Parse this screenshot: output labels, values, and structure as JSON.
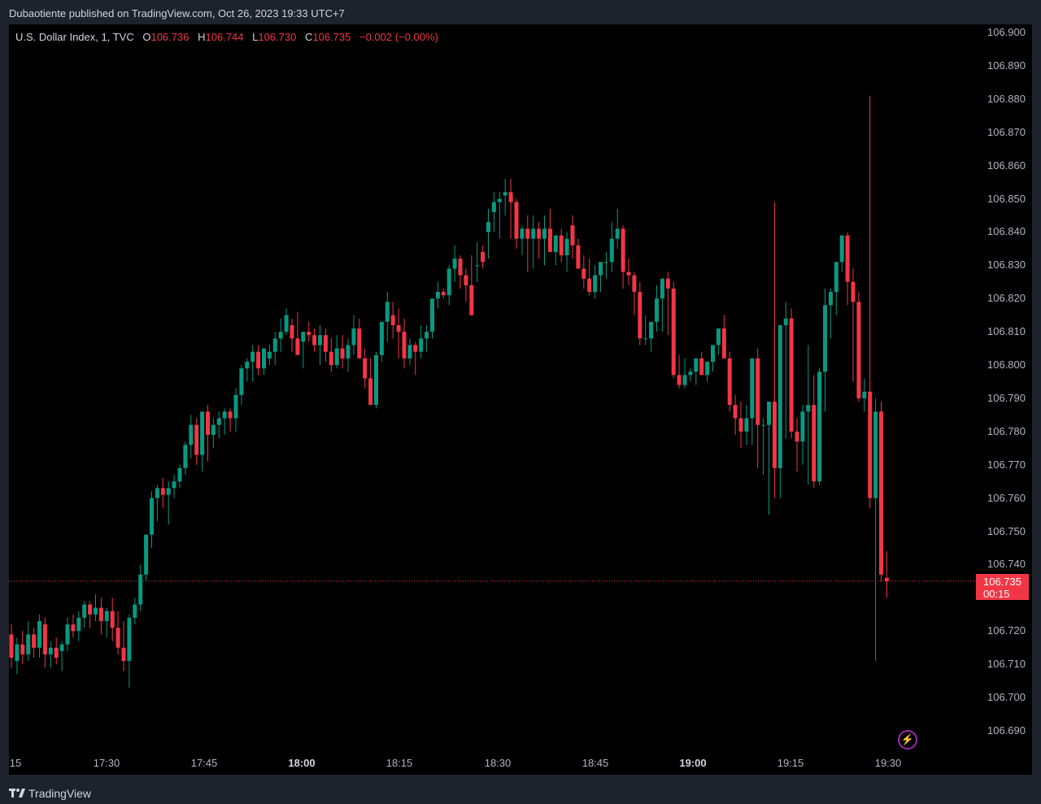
{
  "header": {
    "published_line": "Dubaotiente published on TradingView.com, Oct 26, 2023 19:33 UTC+7"
  },
  "legend": {
    "symbol": "U.S. Dollar Index, 1, TVC",
    "o_label": "O",
    "o_value": "106.736",
    "h_label": "H",
    "h_value": "106.744",
    "l_label": "L",
    "l_value": "106.730",
    "c_label": "C",
    "c_value": "106.735",
    "change": "−0.002 (−0.00%)"
  },
  "price_axis": {
    "ticks": [
      "106.900",
      "106.890",
      "106.880",
      "106.870",
      "106.860",
      "106.850",
      "106.840",
      "106.830",
      "106.820",
      "106.810",
      "106.800",
      "106.790",
      "106.780",
      "106.770",
      "106.760",
      "106.750",
      "106.740",
      "106.720",
      "106.710",
      "106.700",
      "106.690"
    ]
  },
  "last_price": {
    "value": "106.735",
    "countdown": "00:15"
  },
  "time_axis": {
    "labels": [
      {
        "text": "15",
        "bold": false
      },
      {
        "text": "17:30",
        "bold": false
      },
      {
        "text": "17:45",
        "bold": false
      },
      {
        "text": "18:00",
        "bold": true
      },
      {
        "text": "18:15",
        "bold": false
      },
      {
        "text": "18:30",
        "bold": false
      },
      {
        "text": "18:45",
        "bold": false
      },
      {
        "text": "19:00",
        "bold": true
      },
      {
        "text": "19:15",
        "bold": false
      },
      {
        "text": "19:30",
        "bold": false
      }
    ]
  },
  "footer": {
    "brand": "TradingView"
  },
  "colors": {
    "up": "#089981",
    "down": "#f23645",
    "background": "#000000",
    "frame": "#1e222d"
  },
  "chart_data": {
    "type": "candlestick",
    "ylim": [
      106.686,
      106.904
    ],
    "xlabels": [
      "17:30",
      "17:45",
      "18:00",
      "18:15",
      "18:30",
      "18:45",
      "19:00",
      "19:15",
      "19:30"
    ],
    "candles": [
      [
        106.719,
        106.722,
        106.709,
        106.712
      ],
      [
        106.711,
        106.718,
        106.707,
        106.716
      ],
      [
        106.716,
        106.72,
        106.71,
        106.713
      ],
      [
        106.713,
        106.723,
        106.711,
        106.719
      ],
      [
        106.719,
        106.721,
        106.712,
        106.715
      ],
      [
        106.715,
        106.725,
        106.712,
        106.723
      ],
      [
        106.722,
        106.724,
        106.709,
        106.713
      ],
      [
        106.713,
        106.717,
        106.709,
        106.715
      ],
      [
        106.715,
        106.718,
        106.71,
        106.712
      ],
      [
        106.714,
        106.717,
        106.708,
        106.716
      ],
      [
        106.716,
        106.724,
        106.714,
        106.722
      ],
      [
        106.722,
        106.725,
        106.718,
        106.72
      ],
      [
        106.72,
        106.726,
        106.717,
        106.724
      ],
      [
        106.724,
        106.729,
        106.721,
        106.728
      ],
      [
        106.728,
        106.729,
        106.721,
        106.725
      ],
      [
        106.725,
        106.731,
        106.723,
        106.727
      ],
      [
        106.727,
        106.73,
        106.719,
        106.723
      ],
      [
        106.723,
        106.727,
        106.718,
        106.726
      ],
      [
        106.726,
        106.73,
        106.717,
        106.721
      ],
      [
        106.721,
        106.726,
        106.713,
        106.715
      ],
      [
        106.715,
        106.723,
        106.708,
        106.711
      ],
      [
        106.711,
        106.725,
        106.703,
        106.724
      ],
      [
        106.724,
        106.73,
        106.722,
        106.728
      ],
      [
        106.728,
        106.74,
        106.726,
        106.737
      ],
      [
        106.737,
        106.746,
        106.735,
        106.749
      ],
      [
        106.749,
        106.762,
        106.745,
        106.76
      ],
      [
        106.76,
        106.764,
        106.753,
        106.763
      ],
      [
        106.763,
        106.766,
        106.757,
        106.761
      ],
      [
        106.761,
        106.765,
        106.752,
        106.763
      ],
      [
        106.763,
        106.767,
        106.76,
        106.765
      ],
      [
        106.765,
        106.77,
        106.763,
        106.769
      ],
      [
        106.769,
        106.777,
        106.767,
        106.776
      ],
      [
        106.776,
        106.785,
        106.772,
        106.782
      ],
      [
        106.782,
        106.784,
        106.77,
        106.773
      ],
      [
        106.773,
        106.783,
        106.768,
        106.786
      ],
      [
        106.786,
        106.788,
        106.771,
        106.779
      ],
      [
        106.779,
        106.784,
        106.775,
        106.782
      ],
      [
        106.782,
        106.786,
        106.778,
        106.784
      ],
      [
        106.784,
        106.787,
        106.779,
        106.786
      ],
      [
        106.786,
        106.787,
        106.78,
        106.784
      ],
      [
        106.784,
        106.793,
        106.78,
        106.791
      ],
      [
        106.791,
        106.8,
        106.788,
        106.799
      ],
      [
        106.799,
        106.802,
        106.795,
        106.801
      ],
      [
        106.801,
        106.806,
        106.795,
        106.804
      ],
      [
        106.804,
        106.806,
        106.797,
        106.799
      ],
      [
        106.799,
        106.804,
        106.797,
        106.805
      ],
      [
        106.802,
        106.806,
        106.8,
        106.804
      ],
      [
        106.804,
        106.81,
        106.8,
        106.808
      ],
      [
        106.808,
        106.814,
        106.804,
        106.81
      ],
      [
        106.81,
        106.817,
        106.809,
        106.815
      ],
      [
        106.812,
        106.814,
        106.804,
        106.808
      ],
      [
        106.808,
        106.816,
        106.805,
        106.803
      ],
      [
        106.807,
        106.81,
        106.799,
        106.81
      ],
      [
        106.81,
        106.813,
        106.807,
        106.809
      ],
      [
        106.809,
        106.811,
        106.804,
        106.806
      ],
      [
        106.806,
        106.812,
        106.8,
        106.809
      ],
      [
        106.809,
        106.811,
        106.801,
        106.804
      ],
      [
        106.804,
        106.808,
        106.798,
        106.8
      ],
      [
        106.8,
        106.809,
        106.799,
        106.805
      ],
      [
        106.805,
        106.809,
        106.799,
        106.802
      ],
      [
        106.802,
        106.808,
        106.798,
        106.806
      ],
      [
        106.806,
        106.815,
        106.803,
        106.811
      ],
      [
        106.811,
        106.814,
        106.802,
        106.802
      ],
      [
        106.802,
        106.805,
        106.793,
        106.796
      ],
      [
        106.796,
        106.802,
        106.789,
        106.788
      ],
      [
        106.788,
        106.804,
        106.787,
        106.803
      ],
      [
        106.803,
        106.812,
        106.801,
        106.813
      ],
      [
        106.813,
        106.822,
        106.807,
        106.819
      ],
      [
        106.815,
        106.819,
        106.808,
        106.812
      ],
      [
        106.812,
        106.817,
        106.802,
        106.81
      ],
      [
        106.81,
        106.814,
        106.799,
        106.802
      ],
      [
        106.802,
        106.808,
        106.8,
        106.806
      ],
      [
        106.806,
        106.807,
        106.797,
        106.804
      ],
      [
        106.804,
        106.812,
        106.802,
        106.808
      ],
      [
        106.808,
        106.812,
        106.804,
        106.81
      ],
      [
        106.81,
        106.82,
        106.808,
        106.82
      ],
      [
        106.82,
        106.825,
        106.817,
        106.822
      ],
      [
        106.822,
        106.823,
        106.82,
        106.821
      ],
      [
        106.821,
        106.83,
        106.818,
        106.829
      ],
      [
        106.829,
        106.836,
        106.825,
        106.832
      ],
      [
        106.832,
        106.833,
        106.823,
        106.827
      ],
      [
        106.827,
        106.829,
        106.819,
        106.824
      ],
      [
        106.824,
        106.833,
        106.815,
        106.815
      ],
      [
        106.83,
        106.837,
        106.825,
        106.83
      ],
      [
        106.834,
        106.836,
        106.829,
        106.831
      ],
      [
        106.84,
        106.847,
        106.832,
        106.843
      ],
      [
        106.846,
        106.852,
        106.84,
        106.849
      ],
      [
        106.849,
        106.852,
        106.838,
        106.85
      ],
      [
        106.851,
        106.856,
        106.845,
        106.852
      ],
      [
        106.852,
        106.856,
        106.838,
        106.849
      ],
      [
        106.849,
        106.85,
        106.835,
        106.838
      ],
      [
        106.838,
        106.842,
        106.833,
        106.841
      ],
      [
        106.841,
        106.845,
        106.828,
        106.838
      ],
      [
        106.838,
        106.845,
        106.829,
        106.841
      ],
      [
        106.841,
        106.843,
        106.832,
        106.838
      ],
      [
        106.838,
        106.845,
        106.83,
        106.841
      ],
      [
        106.841,
        106.847,
        106.836,
        106.834
      ],
      [
        106.834,
        106.839,
        106.83,
        106.839
      ],
      [
        106.839,
        106.841,
        106.831,
        106.833
      ],
      [
        106.833,
        106.84,
        106.828,
        106.838
      ],
      [
        106.842,
        106.845,
        106.832,
        106.836
      ],
      [
        106.836,
        106.838,
        106.829,
        106.829
      ],
      [
        106.829,
        106.833,
        106.823,
        106.826
      ],
      [
        106.826,
        106.832,
        106.821,
        106.822
      ],
      [
        106.822,
        106.83,
        106.82,
        106.827
      ],
      [
        106.827,
        106.83,
        106.822,
        106.831
      ],
      [
        106.831,
        106.834,
        106.826,
        106.831
      ],
      [
        106.831,
        106.843,
        106.828,
        106.838
      ],
      [
        106.838,
        106.847,
        106.835,
        106.841
      ],
      [
        106.841,
        106.842,
        106.823,
        106.828
      ],
      [
        106.828,
        106.832,
        106.824,
        106.827
      ],
      [
        106.827,
        106.828,
        106.815,
        106.822
      ],
      [
        106.822,
        106.825,
        106.806,
        106.808
      ],
      [
        106.808,
        106.815,
        106.806,
        106.808
      ],
      [
        106.808,
        106.812,
        106.804,
        106.813
      ],
      [
        106.813,
        106.824,
        106.81,
        106.82
      ],
      [
        106.82,
        106.826,
        106.81,
        106.826
      ],
      [
        106.826,
        106.828,
        106.809,
        106.823
      ],
      [
        106.823,
        106.825,
        106.796,
        106.797
      ],
      [
        106.797,
        106.803,
        106.793,
        106.794
      ],
      [
        106.794,
        106.802,
        106.793,
        106.797
      ],
      [
        106.797,
        106.799,
        106.795,
        106.798
      ],
      [
        106.798,
        106.801,
        106.794,
        106.802
      ],
      [
        106.802,
        106.804,
        106.797,
        106.797
      ],
      [
        106.797,
        106.8,
        106.795,
        106.801
      ],
      [
        106.801,
        106.806,
        106.798,
        106.806
      ],
      [
        106.806,
        106.809,
        106.803,
        106.811
      ],
      [
        106.811,
        106.815,
        106.807,
        106.802
      ],
      [
        106.802,
        106.804,
        106.786,
        106.788
      ],
      [
        106.788,
        106.791,
        106.779,
        106.784
      ],
      [
        106.784,
        106.789,
        106.775,
        106.78
      ],
      [
        106.78,
        106.788,
        106.776,
        106.784
      ],
      [
        106.784,
        106.793,
        106.776,
        106.802
      ],
      [
        106.802,
        106.805,
        106.769,
        106.782
      ],
      [
        106.782,
        106.784,
        106.767,
        106.782
      ],
      [
        106.782,
        106.785,
        106.755,
        106.789
      ],
      [
        106.789,
        106.849,
        106.76,
        106.769
      ],
      [
        106.769,
        106.811,
        106.76,
        106.812
      ],
      [
        106.812,
        106.819,
        106.778,
        106.814
      ],
      [
        106.814,
        106.817,
        106.778,
        106.78
      ],
      [
        106.78,
        106.784,
        106.768,
        106.777
      ],
      [
        106.777,
        106.788,
        106.77,
        106.786
      ],
      [
        106.786,
        106.806,
        106.764,
        106.788
      ],
      [
        106.788,
        106.797,
        106.763,
        106.765
      ],
      [
        106.765,
        106.799,
        106.764,
        106.798
      ],
      [
        106.798,
        106.823,
        106.786,
        106.818
      ],
      [
        106.818,
        106.823,
        106.808,
        106.822
      ],
      [
        106.822,
        106.83,
        106.815,
        106.831
      ],
      [
        106.831,
        106.838,
        106.828,
        106.839
      ],
      [
        106.839,
        106.84,
        106.818,
        106.825
      ],
      [
        106.825,
        106.829,
        106.795,
        106.819
      ],
      [
        106.819,
        106.822,
        106.789,
        106.79
      ],
      [
        106.79,
        106.796,
        106.786,
        106.792
      ],
      [
        106.792,
        106.881,
        106.757,
        106.76
      ],
      [
        106.76,
        106.79,
        106.711,
        106.786
      ],
      [
        106.786,
        106.789,
        106.735,
        106.737
      ],
      [
        106.736,
        106.744,
        106.73,
        106.735
      ]
    ]
  }
}
